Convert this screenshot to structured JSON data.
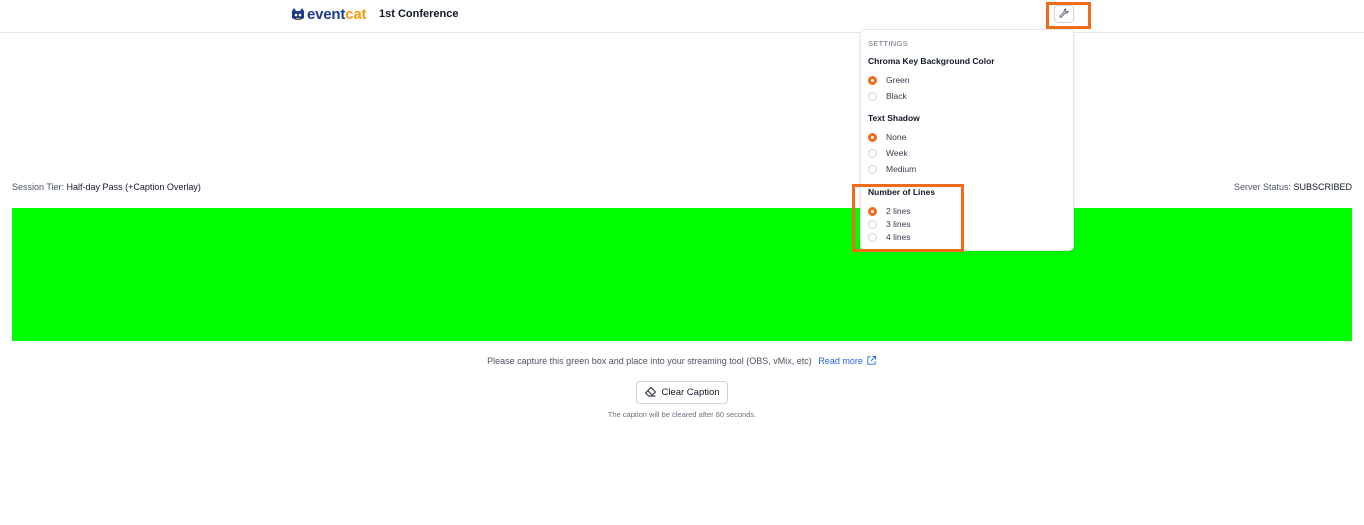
{
  "header": {
    "logo_event": "event",
    "logo_cat": "cat",
    "conference_title": "1st Conference"
  },
  "status": {
    "session_tier_label": "Session Tier:",
    "session_tier_value": "Half-day Pass (+Caption Overlay)",
    "server_status_label": "Server Status:",
    "server_status_value": "SUBSCRIBED"
  },
  "caption_box": {
    "color": "#00ff00"
  },
  "capture_message": {
    "text": "Please capture this green box and place into your streaming tool (OBS, vMix, etc)",
    "read_more": "Read more"
  },
  "clear_caption": {
    "label": "Clear Caption",
    "note": "The caption will be cleared after 60 seconds."
  },
  "settings": {
    "heading": "SETTINGS",
    "chroma": {
      "title": "Chroma Key Background Color",
      "options": [
        "Green",
        "Black"
      ],
      "selected": "Green"
    },
    "shadow": {
      "title": "Text Shadow",
      "options": [
        "None",
        "Week",
        "Medium"
      ],
      "selected": "None"
    },
    "lines": {
      "title": "Number of Lines",
      "options": [
        "2 lines",
        "3 lines",
        "4 lines"
      ],
      "selected": "2 lines"
    }
  },
  "colors": {
    "accent": "#f26b1d",
    "link": "#2563eb"
  }
}
